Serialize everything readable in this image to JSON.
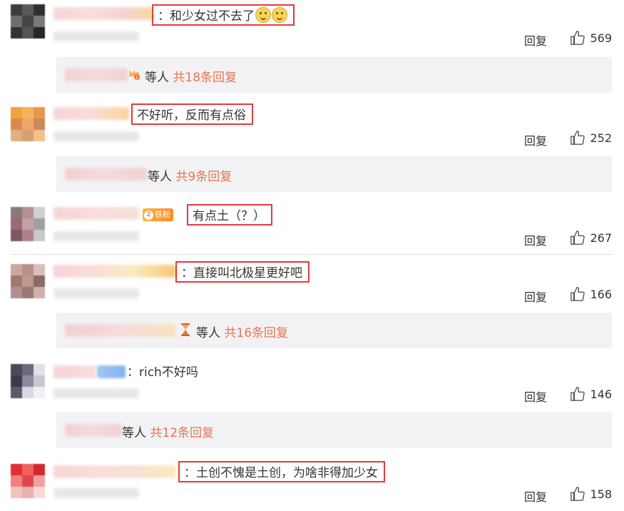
{
  "colors": {
    "highlight_border": "#e23b3b",
    "link_orange": "#eb7350",
    "reply_box_bg": "#f2f2f5"
  },
  "comments": [
    {
      "text_prefix": "：",
      "text": "和少女过不去了",
      "emoji": [
        "doge-emoji",
        "doge-emoji"
      ],
      "highlighted": true,
      "reply_label": "回复",
      "likes": "569",
      "replies": {
        "suffix": "等人",
        "count_text": "共18条回复"
      }
    },
    {
      "text_prefix": "",
      "text": "不好听，反而有点俗",
      "highlighted": true,
      "reply_label": "回复",
      "likes": "252",
      "replies": {
        "suffix": "等人",
        "count_text": "共9条回复"
      }
    },
    {
      "text_prefix": "",
      "text": "有点土（？）",
      "highlighted": true,
      "badge": {
        "level": "2",
        "label": "铁粉"
      },
      "reply_label": "回复",
      "likes": "267"
    },
    {
      "text_prefix": "：",
      "text": "直接叫北极星更好吧",
      "highlighted": true,
      "reply_label": "回复",
      "likes": "166",
      "replies": {
        "suffix": "等人",
        "count_text": "共16条回复"
      }
    },
    {
      "text_prefix": "：",
      "text": "rich不好吗",
      "highlighted": false,
      "reply_label": "回复",
      "likes": "146",
      "replies": {
        "suffix": "等人",
        "count_text": "共12条回复"
      }
    },
    {
      "text_prefix": "：",
      "text": "土创不愧是土创，为啥非得加少女",
      "highlighted": true,
      "reply_label": "回复",
      "likes": "158"
    }
  ]
}
